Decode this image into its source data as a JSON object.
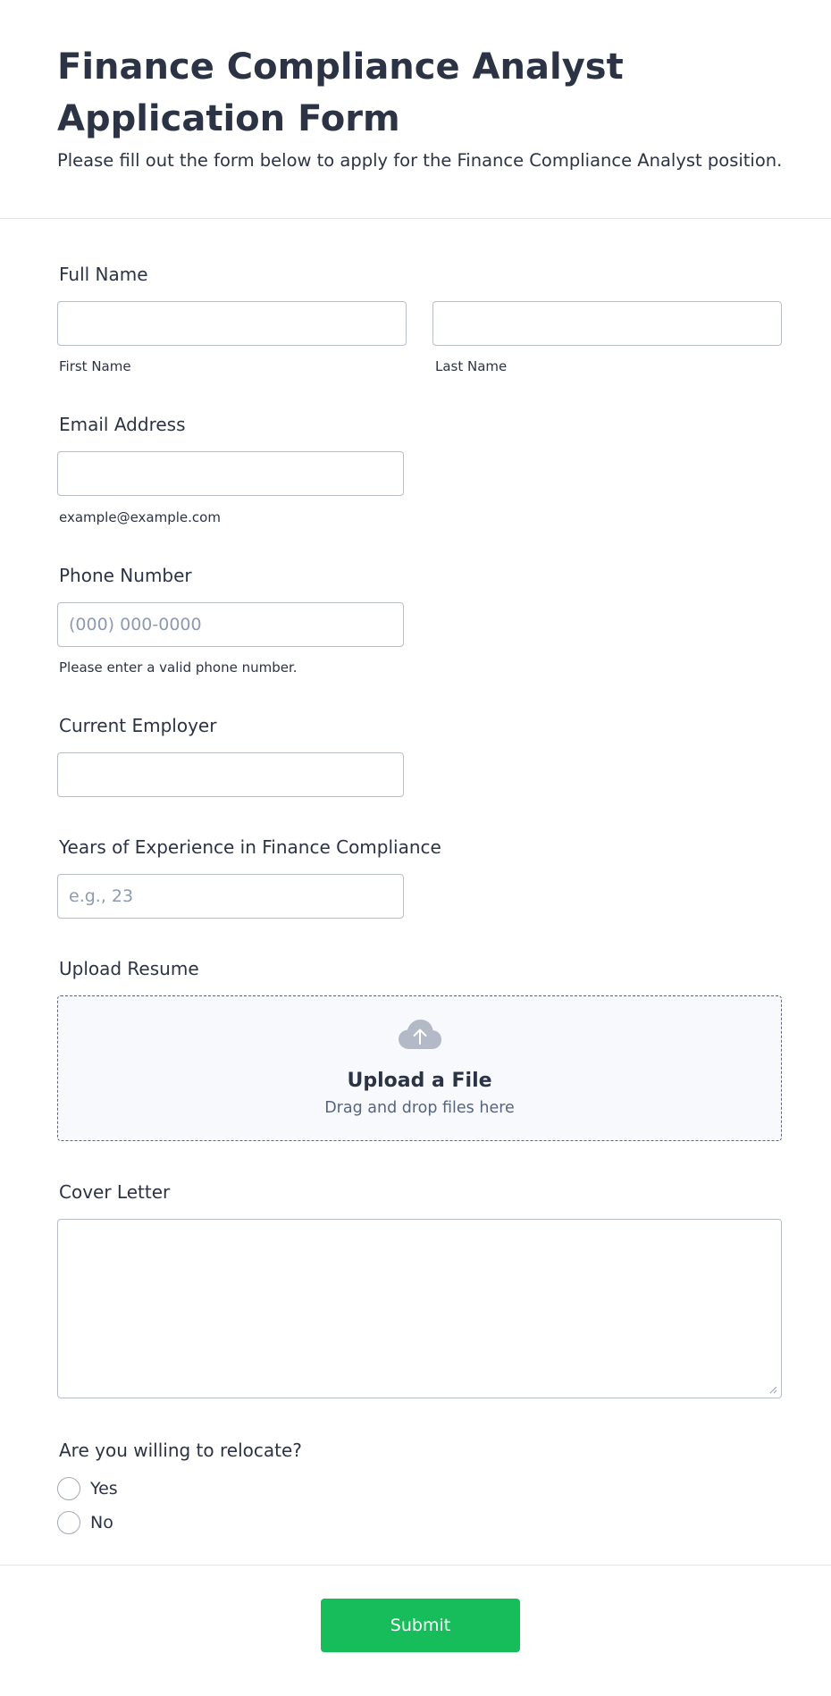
{
  "header": {
    "title": "Finance Compliance Analyst Application Form",
    "subtitle": "Please fill out the form below to apply for the Finance Compliance Analyst position."
  },
  "full_name": {
    "label": "Full Name",
    "first_value": "",
    "first_sublabel": "First Name",
    "last_value": "",
    "last_sublabel": "Last Name"
  },
  "email": {
    "label": "Email Address",
    "value": "",
    "sublabel": "example@example.com"
  },
  "phone": {
    "label": "Phone Number",
    "placeholder": "(000) 000-0000",
    "value": "",
    "sublabel": "Please enter a valid phone number."
  },
  "employer": {
    "label": "Current Employer",
    "value": ""
  },
  "experience": {
    "label": "Years of Experience in Finance Compliance",
    "placeholder": "e.g., 23",
    "value": ""
  },
  "resume": {
    "label": "Upload Resume",
    "title": "Upload a File",
    "hint": "Drag and drop files here",
    "icon": "cloud-upload-icon"
  },
  "cover_letter": {
    "label": "Cover Letter",
    "value": ""
  },
  "relocate": {
    "label": "Are you willing to relocate?",
    "options": [
      "Yes",
      "No"
    ],
    "selected": null
  },
  "submit": {
    "label": "Submit",
    "color": "#18bd5b"
  }
}
